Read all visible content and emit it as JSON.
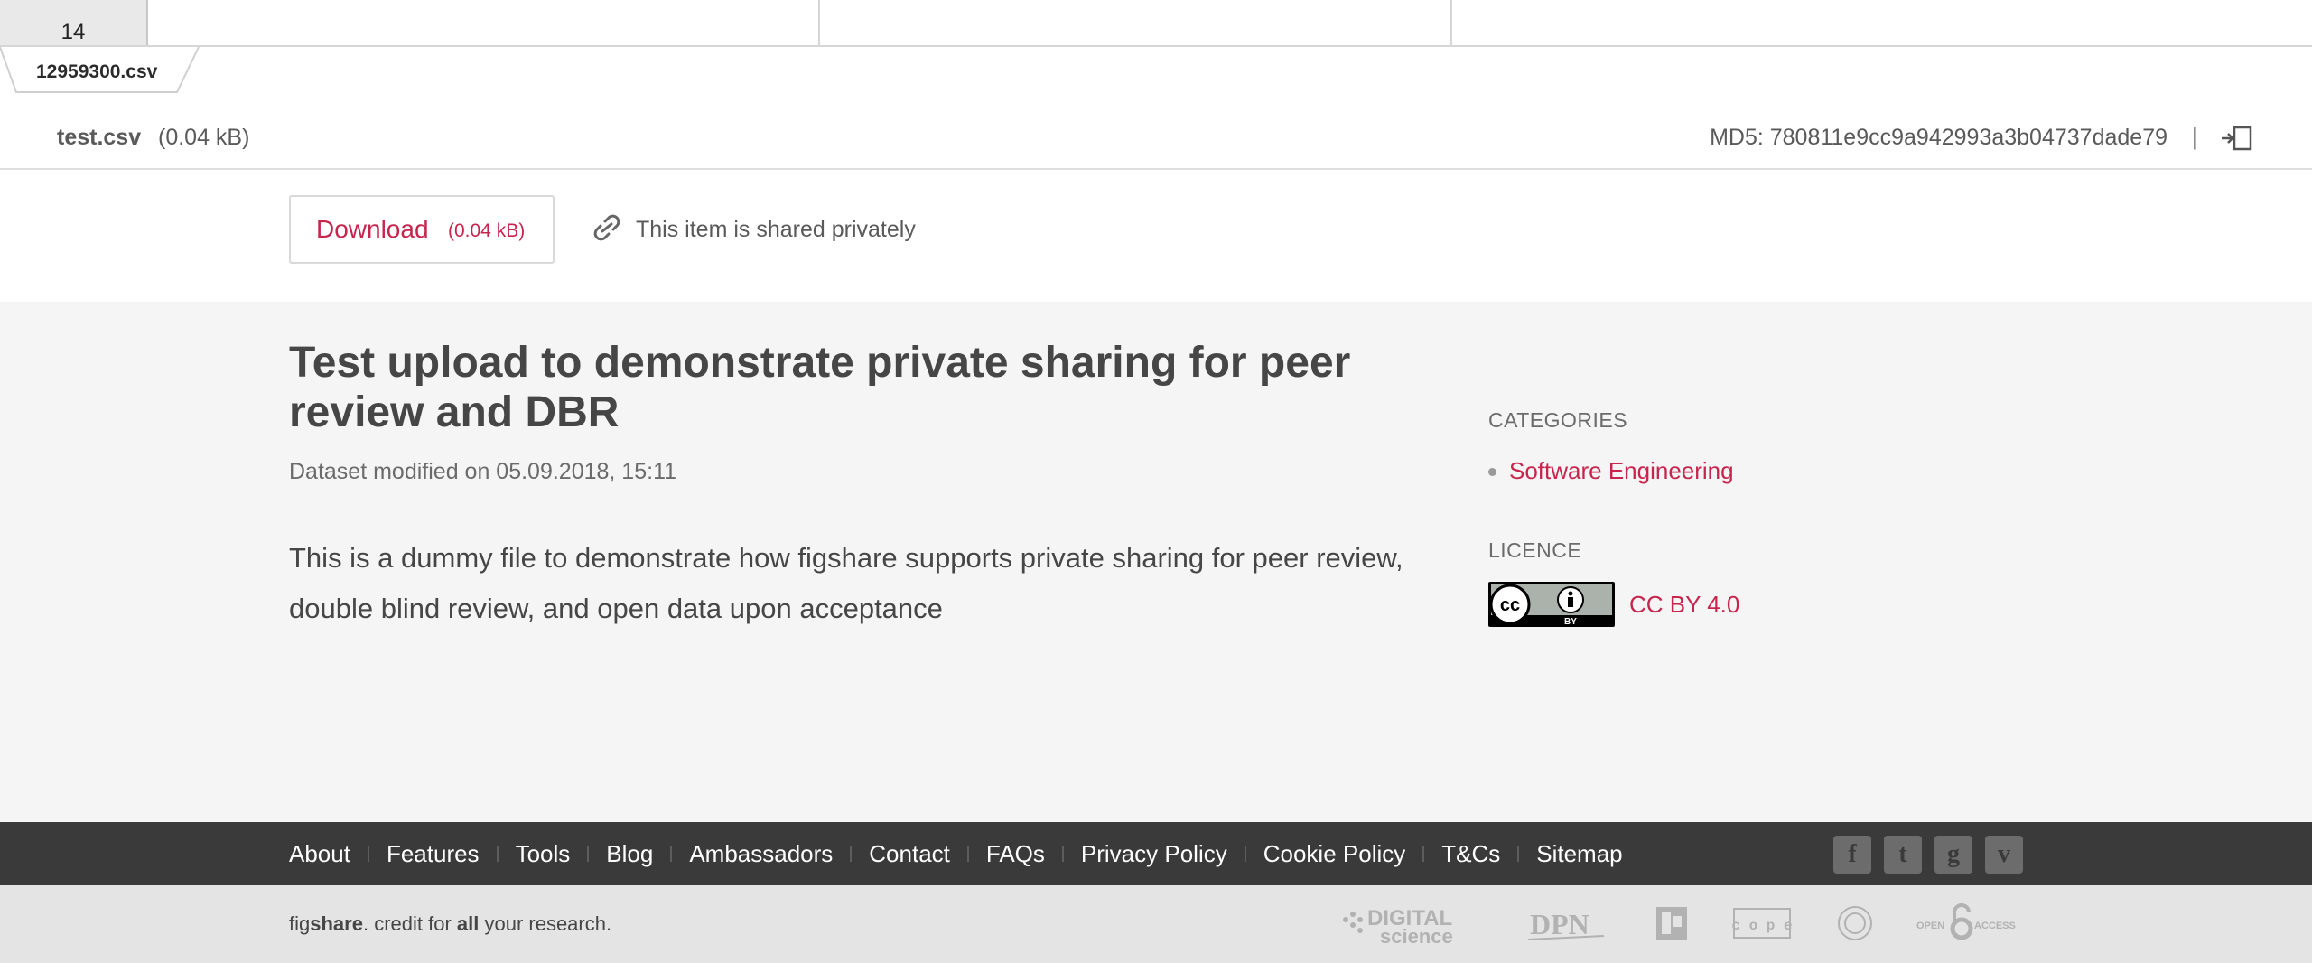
{
  "sheet": {
    "row_number": "14"
  },
  "file_tab": {
    "label": "12959300.csv"
  },
  "file_bar": {
    "name": "test.csv",
    "size": "(0.04 kB)",
    "md5": "MD5: 780811e9cc9a942993a3b04737dade79",
    "separator": "|"
  },
  "actions": {
    "download_label": "Download",
    "download_size": "(0.04 kB)",
    "share_text": "This item is shared privately"
  },
  "item": {
    "title": "Test upload to demonstrate private sharing for peer review and DBR",
    "modified": "Dataset modified on 05.09.2018, 15:11",
    "description": "This is a dummy file to demonstrate how figshare supports private sharing for peer review, double blind review, and open data upon acceptance"
  },
  "sidebar": {
    "categories_heading": "CATEGORIES",
    "categories": [
      "Software Engineering"
    ],
    "licence_heading": "LICENCE",
    "licence_badge_text": "BY",
    "licence_link": "CC BY 4.0"
  },
  "footer": {
    "links": [
      "About",
      "Features",
      "Tools",
      "Blog",
      "Ambassadors",
      "Contact",
      "FAQs",
      "Privacy Policy",
      "Cookie Policy",
      "T&Cs",
      "Sitemap"
    ],
    "social": [
      {
        "icon": "facebook-icon",
        "glyph": "f"
      },
      {
        "icon": "twitter-icon",
        "glyph": "t"
      },
      {
        "icon": "google-plus-icon",
        "glyph": "g"
      },
      {
        "icon": "vimeo-icon",
        "glyph": "v"
      }
    ],
    "tagline": {
      "fig": "fig",
      "share": "share",
      "middle": ". credit for ",
      "all": "all",
      "end": " your research."
    },
    "partners": {
      "digital": "DIGITAL",
      "science": "science",
      "dpn": "DPN",
      "cope": "c o p e",
      "open": "OPEN",
      "access": "ACCESS"
    }
  },
  "colors": {
    "accent": "#c7254e",
    "footer_dark": "#3a3a3a",
    "main_bg": "#f5f5f5"
  }
}
